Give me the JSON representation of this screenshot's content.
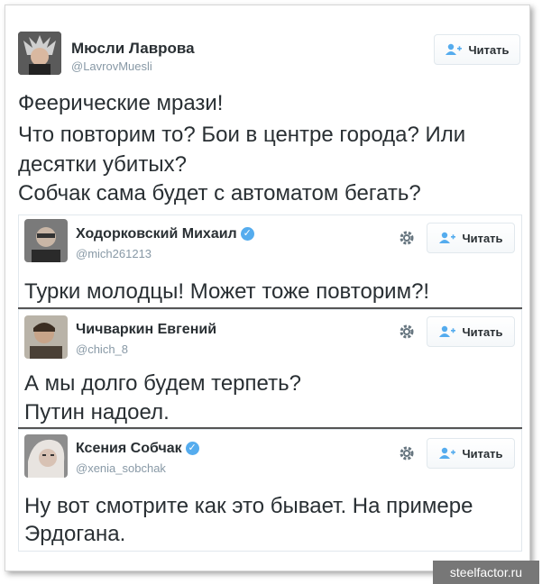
{
  "main": {
    "name": "Мюсли Лаврова",
    "handle": "@LavrovMuesli",
    "follow_label": "Читать",
    "text_lines": [
      "Феерические мрази!",
      "Что повторим то? Бои в центре города? Или",
      "десятки убитых?",
      "Собчак сама будет с автоматом бегать?"
    ]
  },
  "quotes": [
    {
      "name": "Ходорковский Михаил",
      "handle": "@mich261213",
      "verified": true,
      "follow_label": "Читать",
      "text_lines": [
        "Турки молодцы! Может тоже повторим?!"
      ]
    },
    {
      "name": "Чичваркин Евгений",
      "handle": "@chich_8",
      "verified": false,
      "follow_label": "Читать",
      "text_lines": [
        "А мы долго будем терпеть?",
        "Путин надоел."
      ]
    },
    {
      "name": "Ксения Собчак",
      "handle": "@xenia_sobchak",
      "verified": true,
      "follow_label": "Читать",
      "text_lines": [
        "Ну вот смотрите как это бывает. На примере",
        "Эрдогана."
      ]
    }
  ],
  "watermark": "steelfactor.ru",
  "colors": {
    "verified": "#55acee",
    "follow_icon": "#55acee",
    "handle": "#8899a6"
  }
}
